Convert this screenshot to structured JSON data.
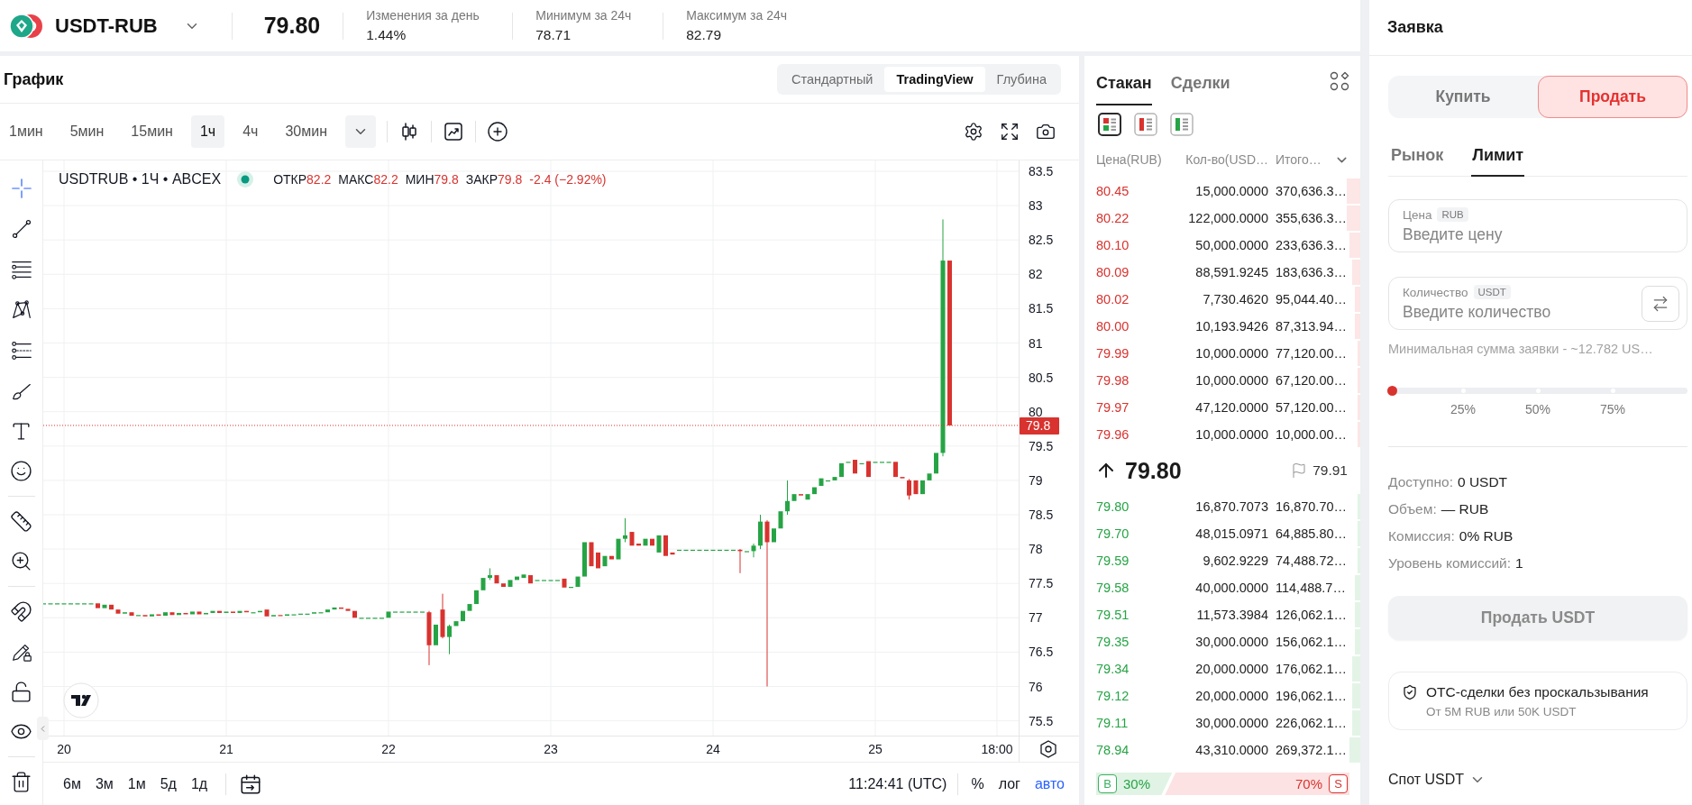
{
  "top_bar": {
    "pair": "USDT-RUB",
    "price": "79.80",
    "stats": [
      {
        "label": "Изменения за день",
        "value": "1.44%"
      },
      {
        "label": "Минимум за 24ч",
        "value": "78.71"
      },
      {
        "label": "Максимум за 24ч",
        "value": "82.79"
      }
    ]
  },
  "chart": {
    "title": "График",
    "views": [
      {
        "label": "Стандартный",
        "selected": false
      },
      {
        "label": "TradingView",
        "selected": true
      },
      {
        "label": "Глубина",
        "selected": false
      }
    ],
    "intervals": [
      {
        "label": "1мин",
        "selected": false
      },
      {
        "label": "5мин",
        "selected": false
      },
      {
        "label": "15мин",
        "selected": false
      },
      {
        "label": "1ч",
        "selected": true
      },
      {
        "label": "4ч",
        "selected": false
      },
      {
        "label": "30мин",
        "selected": false
      }
    ],
    "tool_groups": [
      {
        "tools": [
          {
            "kind": "crosshair",
            "selected": true
          },
          {
            "kind": "trend-line",
            "selected": false
          },
          {
            "kind": "fib",
            "selected": false
          },
          {
            "kind": "pattern",
            "selected": false
          },
          {
            "kind": "forecast",
            "selected": false
          },
          {
            "kind": "brush",
            "selected": false
          },
          {
            "kind": "text",
            "selected": false
          },
          {
            "kind": "emoji",
            "selected": false
          }
        ]
      },
      {
        "tools": [
          {
            "kind": "ruler",
            "selected": false
          },
          {
            "kind": "zoom",
            "selected": false
          }
        ]
      },
      {
        "tools": [
          {
            "kind": "magnet",
            "selected": false
          },
          {
            "kind": "lock-drawings",
            "selected": false
          },
          {
            "kind": "lock",
            "selected": false
          },
          {
            "kind": "hide",
            "selected": false
          }
        ]
      },
      {
        "tools": [
          {
            "kind": "trash",
            "selected": false
          }
        ]
      }
    ],
    "legend": {
      "symbol": "USDTRUB • 1Ч • ABCEX",
      "market_open": true,
      "falling": true,
      "values": [
        {
          "label": "ОТКР",
          "value": "82.2"
        },
        {
          "label": "МАКС",
          "value": "82.2"
        },
        {
          "label": "МИН",
          "value": "79.8"
        },
        {
          "label": "ЗАКР",
          "value": "79.8"
        }
      ],
      "change": "-2.4 (−2.92%)"
    },
    "price_axis": [
      "83.5",
      "83",
      "82.5",
      "82",
      "81.5",
      "81",
      "80.5",
      "80",
      "79.5",
      "79",
      "78.5",
      "78",
      "77.5",
      "77",
      "76.5",
      "76",
      "75.5"
    ],
    "time_axis": [
      "20",
      "21",
      "22",
      "23",
      "24",
      "25",
      "18:00"
    ],
    "last_price_tag": "79.8",
    "ranges": [
      "6м",
      "3м",
      "1м",
      "5д",
      "1д"
    ],
    "clock": "11:24:41 (UTC)",
    "scale_options": [
      {
        "label": "%",
        "selected": false
      },
      {
        "label": "лог",
        "selected": false
      },
      {
        "label": "авто",
        "selected": true
      }
    ]
  },
  "order_book": {
    "tabs": [
      {
        "label": "Стакан",
        "selected": true
      },
      {
        "label": "Сделки",
        "selected": false
      }
    ],
    "views": [
      {
        "kind": "both",
        "selected": true
      },
      {
        "kind": "asks",
        "selected": false
      },
      {
        "kind": "bids",
        "selected": false
      }
    ],
    "columns": [
      "Цена(RUB)",
      "Кол-во(USD…",
      "Итого…"
    ],
    "asks": [
      {
        "price": "80.45",
        "amount": "15,000.0000",
        "total": "370,636.3…",
        "level": 0.05
      },
      {
        "price": "80.22",
        "amount": "122,000.0000",
        "total": "355,636.3…",
        "level": 0.05
      },
      {
        "price": "80.10",
        "amount": "50,000.0000",
        "total": "233,636.3…",
        "level": 0.04
      },
      {
        "price": "80.09",
        "amount": "88,591.9245",
        "total": "183,636.3…",
        "level": 0.03
      },
      {
        "price": "80.02",
        "amount": "7,730.4620",
        "total": "95,044.40…",
        "level": 0.02
      },
      {
        "price": "80.00",
        "amount": "10,193.9426",
        "total": "87,313.94…",
        "level": 0.02
      },
      {
        "price": "79.99",
        "amount": "10,000.0000",
        "total": "77,120.00…",
        "level": 0.01
      },
      {
        "price": "79.98",
        "amount": "10,000.0000",
        "total": "67,120.00…",
        "level": 0.01
      },
      {
        "price": "79.97",
        "amount": "47,120.0000",
        "total": "57,120.00…",
        "level": 0.01
      },
      {
        "price": "79.96",
        "amount": "10,000.0000",
        "total": "10,000.00…",
        "level": 0.01
      }
    ],
    "mid": {
      "rising": true,
      "price": "79.80",
      "mark_price": "79.91"
    },
    "bids": [
      {
        "price": "79.80",
        "amount": "16,870.7073",
        "total": "16,870.70…",
        "level": 0.01
      },
      {
        "price": "79.70",
        "amount": "48,015.0971",
        "total": "64,885.80…",
        "level": 0.01
      },
      {
        "price": "79.59",
        "amount": "9,602.9229",
        "total": "74,488.72…",
        "level": 0.01
      },
      {
        "price": "79.58",
        "amount": "40,000.0000",
        "total": "114,488.7…",
        "level": 0.02
      },
      {
        "price": "79.51",
        "amount": "11,573.3984",
        "total": "126,062.1…",
        "level": 0.02
      },
      {
        "price": "79.35",
        "amount": "30,000.0000",
        "total": "156,062.1…",
        "level": 0.02
      },
      {
        "price": "79.34",
        "amount": "20,000.0000",
        "total": "176,062.1…",
        "level": 0.03
      },
      {
        "price": "79.12",
        "amount": "20,000.0000",
        "total": "196,062.1…",
        "level": 0.03
      },
      {
        "price": "79.11",
        "amount": "30,000.0000",
        "total": "226,062.1…",
        "level": 0.03
      },
      {
        "price": "78.94",
        "amount": "43,310.0000",
        "total": "269,372.1…",
        "level": 0.04
      }
    ],
    "ratio": {
      "buy_label": "B",
      "buy_share": "30%",
      "sell_share": "70%",
      "sell_label": "S",
      "level": 0.3
    }
  },
  "order_form": {
    "title": "Заявка",
    "sides": [
      {
        "label": "Купить",
        "selected": false
      },
      {
        "label": "Продать",
        "selected": true
      }
    ],
    "types": [
      {
        "label": "Рынок",
        "selected": false
      },
      {
        "label": "Лимит",
        "selected": true
      }
    ],
    "fields": [
      {
        "label": "Цена",
        "unit": "RUB",
        "placeholder": "Введите цену"
      },
      {
        "label": "Количество",
        "unit": "USDT",
        "placeholder": "Введите количество",
        "swap": true
      }
    ],
    "min_note": "Минимальная сумма заявки - ~12.782 US…",
    "slider": {
      "level": 0,
      "marks": [
        "25%",
        "50%",
        "75%"
      ]
    },
    "info": [
      {
        "label": "Доступно:",
        "value": "0 USDT"
      },
      {
        "label": "Объем:",
        "value": "— RUB"
      },
      {
        "label": "Комиссия:",
        "value": "0% RUB"
      },
      {
        "label": "Уровень комиссий:",
        "value": "1"
      }
    ],
    "submit": {
      "label": "Продать USDT",
      "disabled": true
    },
    "otc": {
      "title": "OTC-сделки без проскальзывания",
      "subtitle": "От 5M RUB или 50K USDT"
    },
    "account": "Спот USDT"
  }
}
